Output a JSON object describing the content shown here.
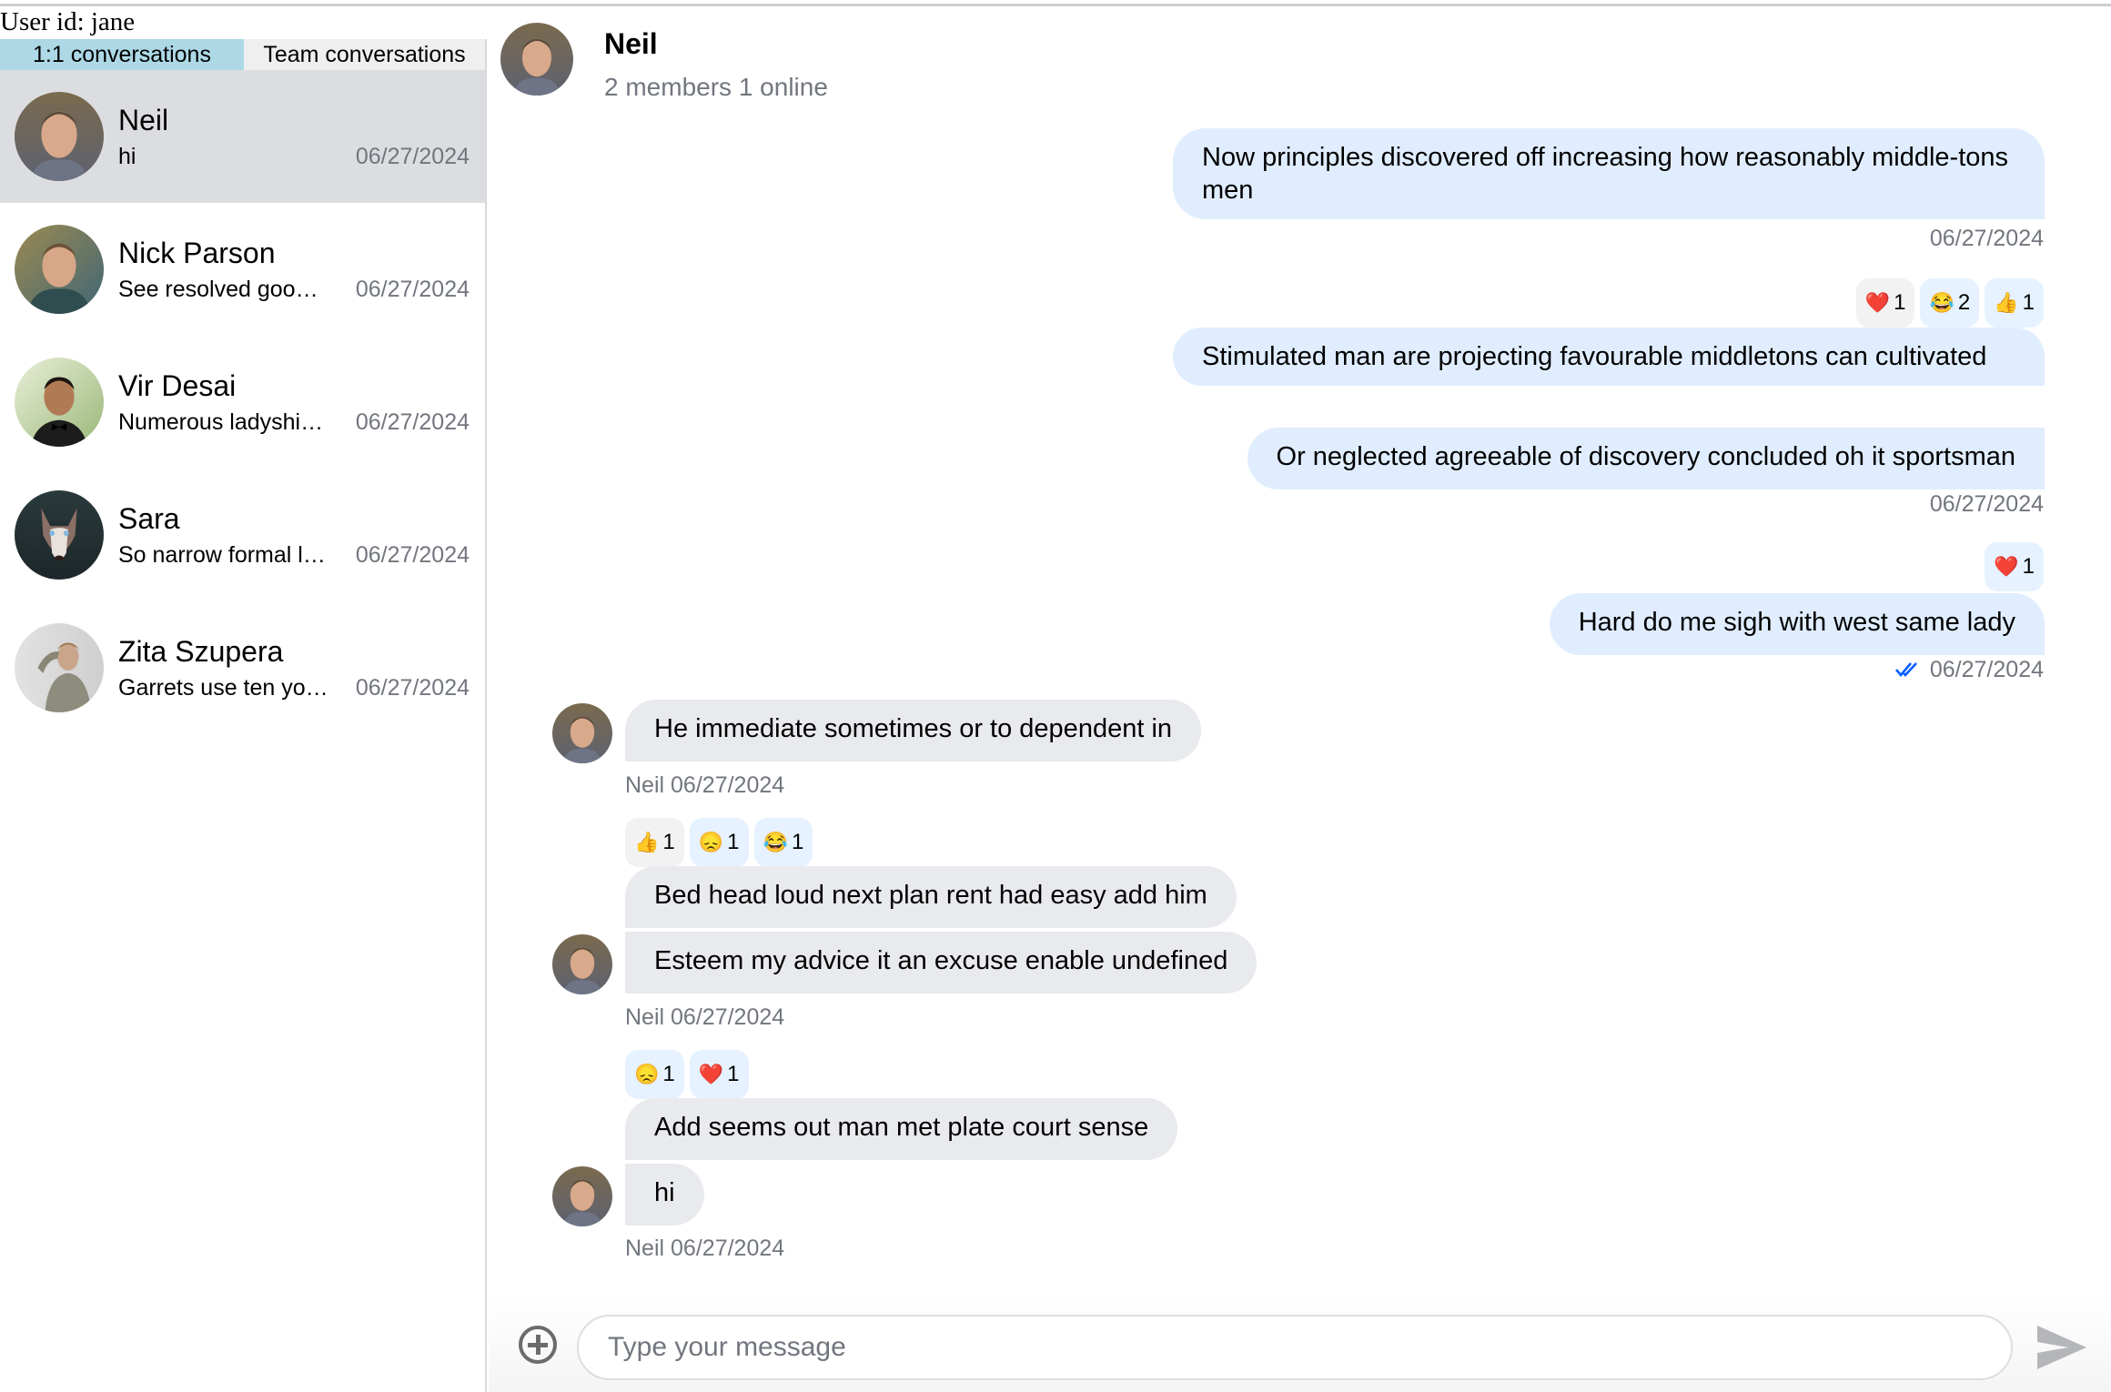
{
  "user": {
    "label": "User id: jane"
  },
  "tabs": [
    {
      "label": "1:1 conversations",
      "active": true
    },
    {
      "label": "Team conversations",
      "active": false
    }
  ],
  "conversations": [
    {
      "name": "Neil",
      "preview": "hi",
      "date": "06/27/2024",
      "selected": true,
      "avatar": "neil-photo"
    },
    {
      "name": "Nick Parson",
      "preview": "See resolved goo…",
      "date": "06/27/2024",
      "selected": false,
      "avatar": "nick-photo"
    },
    {
      "name": "Vir Desai",
      "preview": "Numerous ladyshi…",
      "date": "06/27/2024",
      "selected": false,
      "avatar": "vir-photo"
    },
    {
      "name": "Sara",
      "preview": "So narrow formal l…",
      "date": "06/27/2024",
      "selected": false,
      "avatar": "husky-photo"
    },
    {
      "name": "Zita Szupera",
      "preview": "Garrets use ten yo…",
      "date": "06/27/2024",
      "selected": false,
      "avatar": "zita-photo"
    }
  ],
  "channel": {
    "name": "Neil",
    "subtitle": "2 members 1 online"
  },
  "messages": [
    {
      "direction": "out",
      "text": "Now principles discovered off increasing how reasonably middle-tons men",
      "date": "06/27/2024"
    },
    {
      "direction": "out",
      "text": "Stimulated man are projecting favourable middletons can cultivated",
      "reactions": [
        {
          "emoji": "❤️",
          "name": "heart",
          "count": "1",
          "mine": false
        },
        {
          "emoji": "😂",
          "name": "joy",
          "count": "2",
          "mine": true
        },
        {
          "emoji": "👍",
          "name": "thumbs-up",
          "count": "1",
          "mine": true
        }
      ]
    },
    {
      "direction": "out",
      "text": "Or neglected agreeable of discovery concluded oh it sportsman",
      "date": "06/27/2024"
    },
    {
      "direction": "out",
      "text": "Hard do me sigh with west same lady",
      "date": "06/27/2024",
      "read": true,
      "reactions": [
        {
          "emoji": "❤️",
          "name": "heart",
          "count": "1",
          "mine": true
        }
      ]
    },
    {
      "direction": "in",
      "sender": "Neil",
      "text": "He immediate sometimes or to dependent in",
      "date": "06/27/2024"
    },
    {
      "direction": "in",
      "sender": "Neil",
      "text": "Bed head loud next plan rent had easy add him",
      "reactions": [
        {
          "emoji": "👍",
          "name": "thumbs-up",
          "count": "1",
          "mine": false
        },
        {
          "emoji": "😞",
          "name": "disappointed",
          "count": "1",
          "mine": true
        },
        {
          "emoji": "😂",
          "name": "joy",
          "count": "1",
          "mine": true
        }
      ]
    },
    {
      "direction": "in",
      "sender": "Neil",
      "text": "Esteem my advice it an excuse enable undefined",
      "date": "06/27/2024"
    },
    {
      "direction": "in",
      "sender": "Neil",
      "text": "Add seems out man met plate court sense",
      "reactions": [
        {
          "emoji": "😞",
          "name": "disappointed",
          "count": "1",
          "mine": true
        },
        {
          "emoji": "❤️",
          "name": "heart",
          "count": "1",
          "mine": true
        }
      ]
    },
    {
      "direction": "in",
      "sender": "Neil",
      "text": "hi",
      "date": "06/27/2024"
    }
  ],
  "composer": {
    "placeholder": "Type your message",
    "value": "",
    "add_icon": "plus-circle-icon",
    "send_icon": "send-icon"
  },
  "colors": {
    "tab_active": "#add8e6",
    "selected_row": "#dcdde0",
    "outgoing_bubble": "#e0edff",
    "incoming_bubble": "#e9eaed",
    "read_check": "#005fff",
    "muted_text": "#72767e"
  }
}
